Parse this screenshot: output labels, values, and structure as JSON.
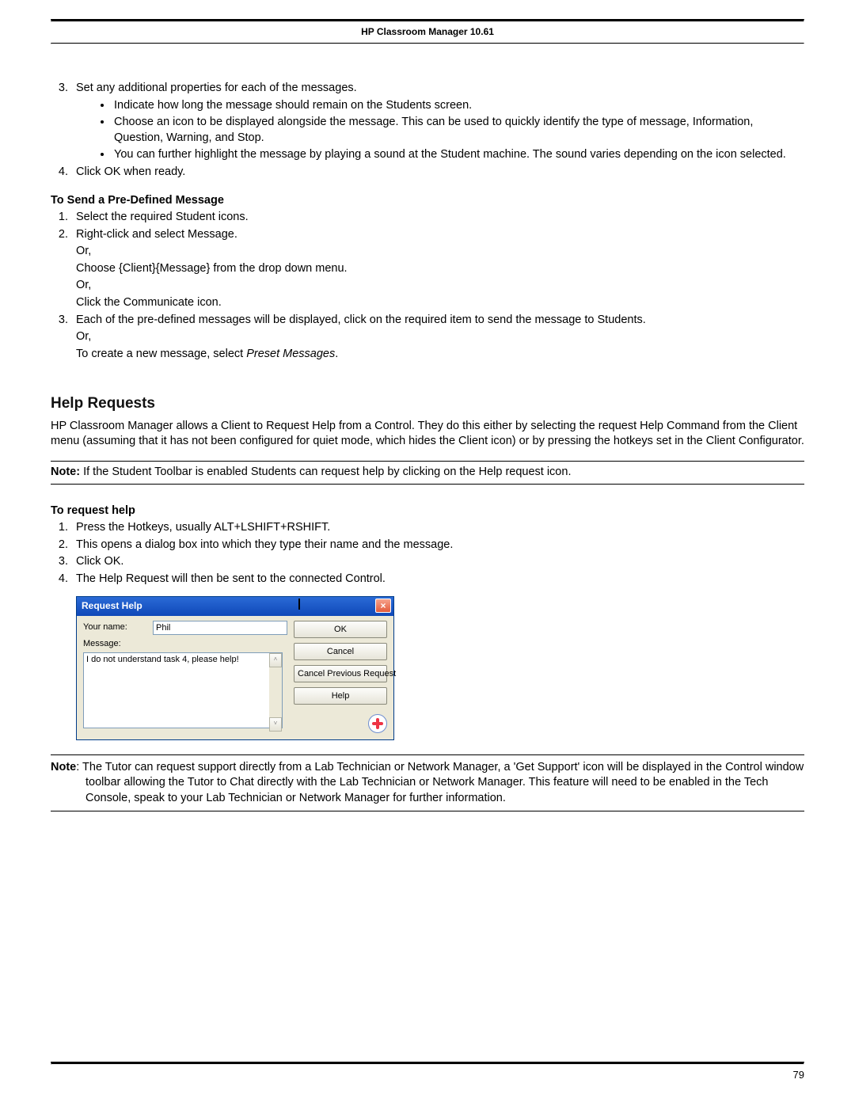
{
  "header": {
    "title": "HP Classroom Manager 10.61"
  },
  "top_list": {
    "item3": "Set any additional properties for each of the messages.",
    "sub_bullets": [
      "Indicate how long the message should remain on the Students screen.",
      "Choose an icon to be displayed alongside the message. This can be used to quickly identify the type of message, Information, Question, Warning, and Stop.",
      "You can further highlight the message by playing a sound at the Student machine. The sound varies depending on the icon selected."
    ],
    "item4": "Click OK when ready."
  },
  "predef": {
    "heading": "To Send a Pre-Defined Message",
    "item1": "Select  the required Student icons.",
    "item2": "Right-click and select Message.",
    "item2_or1": "Or,",
    "item2_alt1": "Choose {Client}{Message} from the drop down menu.",
    "item2_or2": "Or,",
    "item2_alt2": "Click the Communicate icon.",
    "item3": "Each of the pre-defined messages will be displayed, click on the required item to send the message to Students.",
    "item3_or": "Or,",
    "item3_alt_pre": "To create a new message, select ",
    "item3_alt_em": "Preset Messages",
    "item3_alt_post": "."
  },
  "help": {
    "heading": "Help Requests",
    "para": "HP Classroom Manager allows a Client to Request Help from a Control. They do this either by selecting the request Help Command from the Client menu (assuming that it has not been configured for quiet mode, which hides the Client icon) or by pressing the hotkeys set in the Client Configurator.",
    "note_label": "Note:",
    "note_text": " If the Student Toolbar is enabled Students can request help by clicking on the Help request icon.",
    "to_request": "To request help",
    "steps": [
      "Press the Hotkeys, usually ALT+LSHIFT+RSHIFT.",
      "This opens a dialog box into which they type their name and the message.",
      "Click OK.",
      "The Help Request will then be sent to the connected Control."
    ]
  },
  "dialog": {
    "title": "Request Help",
    "name_label": "Your name:",
    "name_value": "Phil",
    "msg_label": "Message:",
    "msg_value": "I do not understand task 4, please help!",
    "btn_ok": "OK",
    "btn_cancel": "Cancel",
    "btn_cancel_prev": "Cancel Previous Request",
    "btn_help": "Help"
  },
  "bottom_note": {
    "label": "Note",
    "text": ": The Tutor can request support directly from a Lab Technician or Network Manager, a 'Get Support' icon will be displayed in the Control window toolbar allowing the Tutor to Chat directly with the Lab Technician or Network Manager. This feature will need to be enabled in the Tech Console, speak to your Lab Technician or Network Manager for further information."
  },
  "page_number": "79"
}
